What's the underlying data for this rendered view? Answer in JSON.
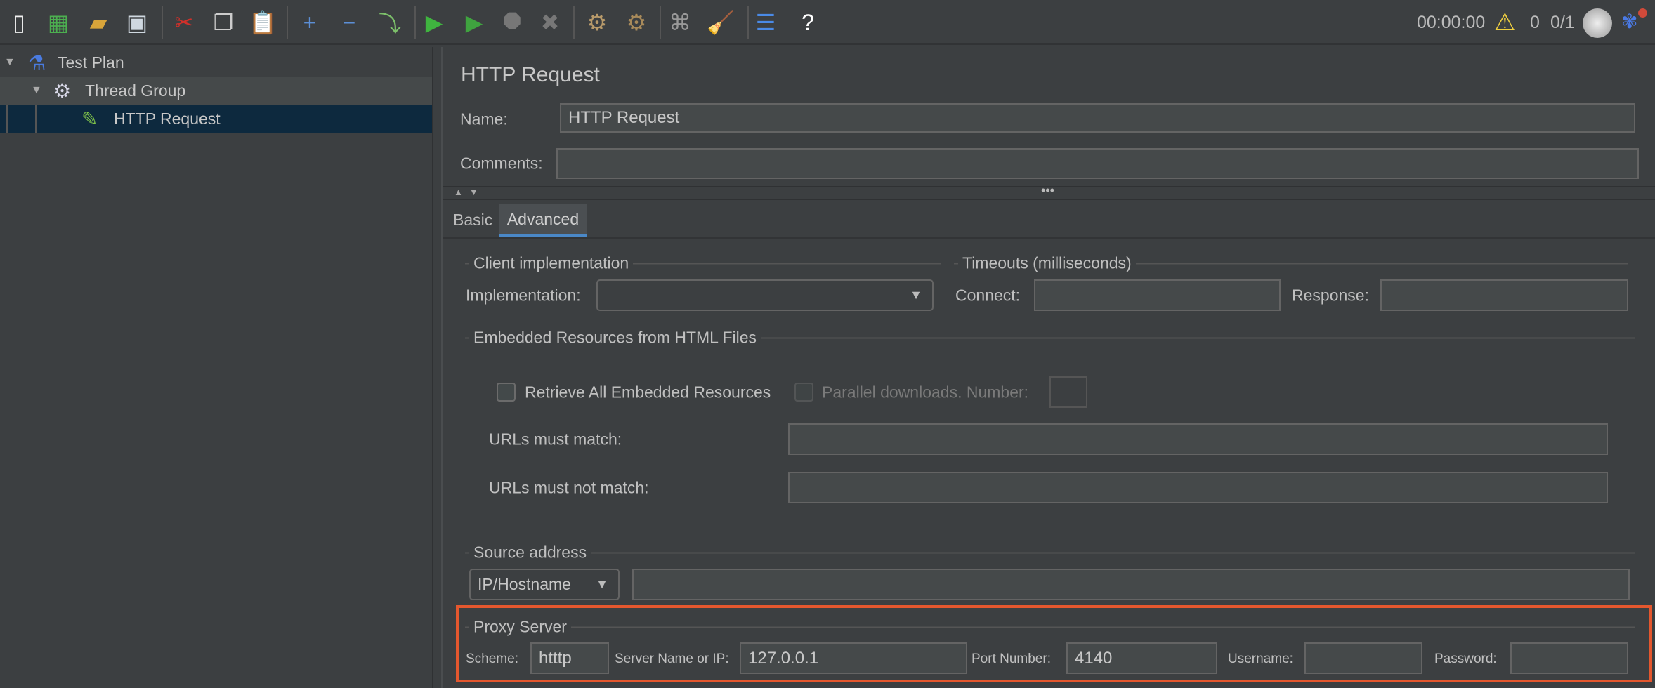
{
  "toolbar": {
    "icons": [
      {
        "name": "new-icon",
        "glyph": "▯",
        "color": "#f0f0f0"
      },
      {
        "name": "templates-icon",
        "glyph": "▦",
        "color": "#4caf50"
      },
      {
        "name": "open-icon",
        "glyph": "▰",
        "color": "#d9a53a"
      },
      {
        "name": "save-icon",
        "glyph": "▣",
        "color": "#cfd8e0"
      },
      {
        "name": "cut-icon",
        "glyph": "✂",
        "color": "#d0302a"
      },
      {
        "name": "copy-icon",
        "glyph": "❐",
        "color": "#cccccc"
      },
      {
        "name": "paste-icon",
        "glyph": "📋",
        "color": "#c89a4a"
      },
      {
        "name": "expand-icon",
        "glyph": "+",
        "color": "#5c8fd6"
      },
      {
        "name": "collapse-icon",
        "glyph": "−",
        "color": "#5c8fd6"
      },
      {
        "name": "toggle-icon",
        "glyph": "⤵",
        "color": "#7cbf6a"
      },
      {
        "name": "start-icon",
        "glyph": "▶",
        "color": "#3fb43f"
      },
      {
        "name": "start-no-pauses-icon",
        "glyph": "▶",
        "color": "#3fa33f"
      },
      {
        "name": "stop-icon",
        "glyph": "⯃",
        "color": "#777777"
      },
      {
        "name": "shutdown-icon",
        "glyph": "✖",
        "color": "#777777"
      },
      {
        "name": "clear-icon",
        "glyph": "⚙",
        "color": "#b89a6a"
      },
      {
        "name": "clear-all-icon",
        "glyph": "⚙",
        "color": "#a88a5a"
      },
      {
        "name": "search-icon",
        "glyph": "⌘",
        "color": "#999999"
      },
      {
        "name": "reset-search-icon",
        "glyph": "🧹",
        "color": "#e8c040"
      },
      {
        "name": "function-helper-icon",
        "glyph": "☰",
        "color": "#4a8ae6"
      },
      {
        "name": "help-icon",
        "glyph": "?",
        "color": "#ffffff"
      }
    ],
    "timer": "00:00:00",
    "warning_count": "0",
    "threads": "0/1"
  },
  "tree": {
    "items": [
      {
        "label": "Test Plan"
      },
      {
        "label": "Thread Group"
      },
      {
        "label": "HTTP Request",
        "selected": true
      }
    ]
  },
  "main": {
    "title": "HTTP Request",
    "name_label": "Name:",
    "name_value": "HTTP Request",
    "comments_label": "Comments:",
    "comments_value": "",
    "tabs": [
      {
        "label": "Basic"
      },
      {
        "label": "Advanced",
        "active": true
      }
    ],
    "client": {
      "legend": "Client implementation",
      "implementation_label": "Implementation:",
      "implementation_value": ""
    },
    "timeouts": {
      "legend": "Timeouts (milliseconds)",
      "connect_label": "Connect:",
      "connect_value": "",
      "response_label": "Response:",
      "response_value": ""
    },
    "embedded": {
      "legend": "Embedded Resources from HTML Files",
      "retrieve_label": "Retrieve All Embedded Resources",
      "retrieve_checked": false,
      "parallel_label": "Parallel downloads. Number:",
      "parallel_checked": false,
      "parallel_value": "",
      "urls_match_label": "URLs must match:",
      "urls_match_value": "",
      "urls_not_match_label": "URLs must not match:",
      "urls_not_match_value": ""
    },
    "source": {
      "legend": "Source address",
      "type_value": "IP/Hostname",
      "address_value": ""
    },
    "proxy": {
      "legend": "Proxy Server",
      "scheme_label": "Scheme:",
      "scheme_value": "htttp",
      "server_label": "Server Name or IP:",
      "server_value": "127.0.0.1",
      "port_label": "Port Number:",
      "port_value": "4140",
      "username_label": "Username:",
      "username_value": "",
      "password_label": "Password:",
      "password_value": "",
      "highlight_color": "#e4572e"
    }
  }
}
